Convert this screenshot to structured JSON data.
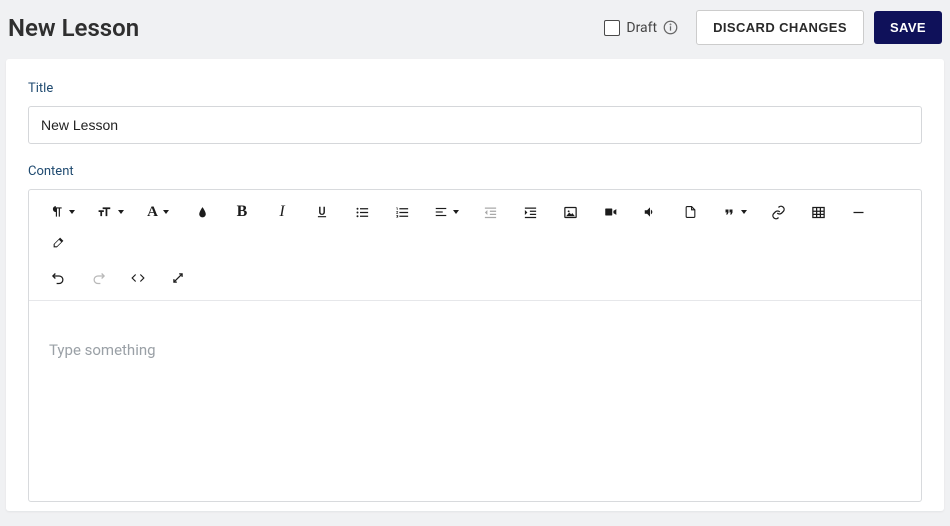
{
  "header": {
    "title": "New Lesson",
    "draft_label": "Draft",
    "discard_label": "DISCARD CHANGES",
    "save_label": "SAVE"
  },
  "form": {
    "title_label": "Title",
    "title_value": "New Lesson",
    "content_label": "Content",
    "placeholder": "Type something"
  }
}
